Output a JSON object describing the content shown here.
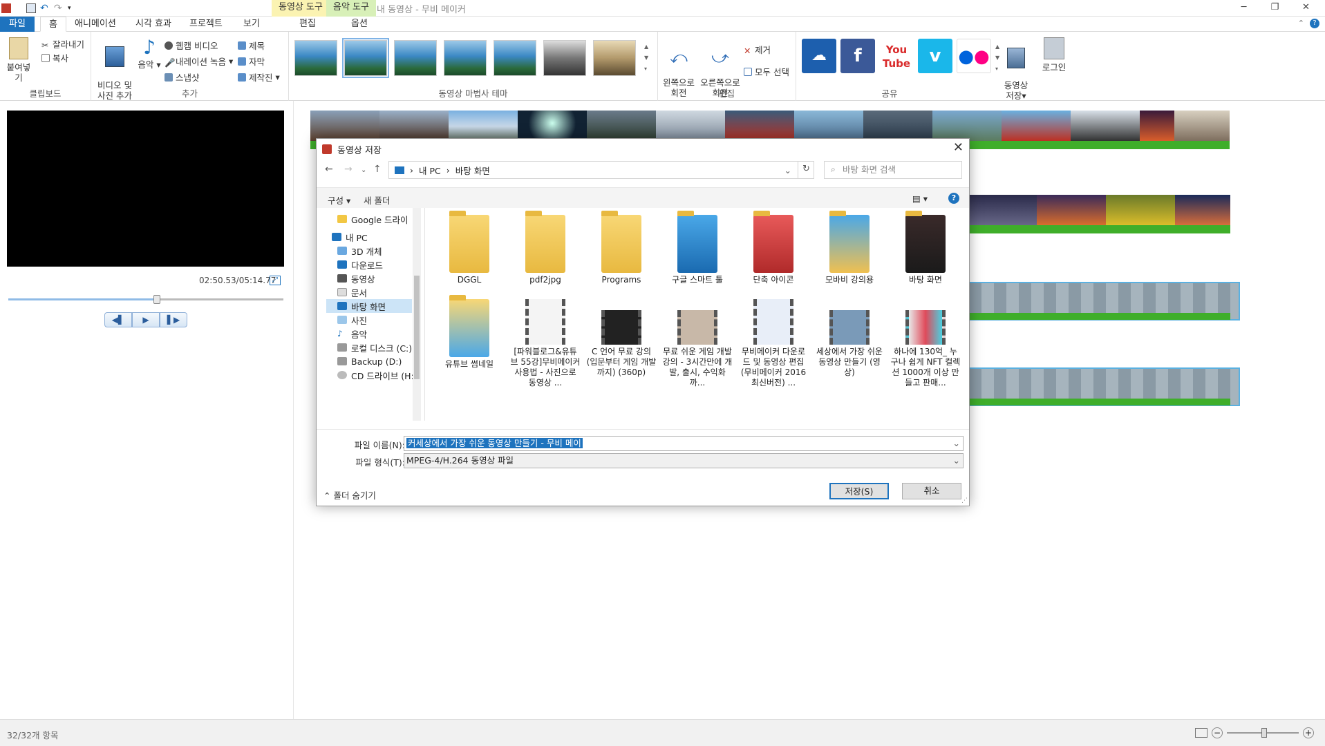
{
  "app": {
    "title": "내 동영상 - 무비 메이커"
  },
  "context_tabs": {
    "video_tools": "동영상 도구",
    "music_tools": "음악 도구",
    "edit": "편집",
    "options": "옵션"
  },
  "tabs": [
    "파일",
    "홈",
    "애니메이션",
    "시각 효과",
    "프로젝트",
    "보기"
  ],
  "ribbon": {
    "paste": "붙여넣기",
    "cut": "잘라내기",
    "copy": "복사",
    "clipboard": "클립보드",
    "add_video": "비디오 및\n사진 추가",
    "music": "음악",
    "webcam": "웹캠 비디오",
    "narration": "내레이션 녹음",
    "snapshot": "스냅샷",
    "title": "제목",
    "caption": "자막",
    "credits": "제작진",
    "add_group": "추가",
    "themes_group": "동영상 마법사 테마",
    "rotate_left": "왼쪽으로\n회전",
    "rotate_right": "오른쪽으로\n회전",
    "remove": "제거",
    "select_all": "모두 선택",
    "edit_group": "편집",
    "share_group": "공유",
    "save_movie": "동영상\n저장",
    "login": "로그인"
  },
  "player": {
    "time": "02:50.53/05:14.77",
    "progress": 0.54
  },
  "status": {
    "count": "32/32개 항목"
  },
  "dialog": {
    "title": "동영상 저장",
    "path": [
      "내 PC",
      "바탕 화면"
    ],
    "search_placeholder": "바탕 화면 검색",
    "organize": "구성",
    "new_folder": "새 폴더",
    "tree": [
      "Google 드라이",
      "내 PC",
      "3D 개체",
      "다운로드",
      "동영상",
      "문서",
      "바탕 화면",
      "사진",
      "음악",
      "로컬 디스크 (C:)",
      "Backup (D:)",
      "CD 드라이브 (H:"
    ],
    "files": [
      {
        "name": "DGGL",
        "kind": "folder"
      },
      {
        "name": "pdf2jpg",
        "kind": "folder"
      },
      {
        "name": "Programs",
        "kind": "folder"
      },
      {
        "name": "구글 스마트 툴",
        "kind": "folder"
      },
      {
        "name": "단축 아이콘",
        "kind": "folder"
      },
      {
        "name": "모바비 강의용",
        "kind": "folder"
      },
      {
        "name": "바탕 화면",
        "kind": "folder"
      },
      {
        "name": "유튜브 썸네일",
        "kind": "folder"
      },
      {
        "name": "[파워블로그&유튜브 55강]무비메이커 사용법 - 사진으로 동영상 ...",
        "kind": "video"
      },
      {
        "name": "C 언어 무료 강의 (입문부터 게임 개발까지) (360p)",
        "kind": "video"
      },
      {
        "name": "무료 쉬운 게임 개발 강의 - 3시간만에 개발, 출시, 수익화까...",
        "kind": "video"
      },
      {
        "name": "무비메이커 다운로드 및 동영상 편집 (무비메이커 2016최신버전) ...",
        "kind": "video"
      },
      {
        "name": "세상에서 가장 쉬운 동영상 만들기 (영상)",
        "kind": "video"
      },
      {
        "name": "하나에 130억_ 누구나 쉽게 NFT 컬렉션 1000개 이상 만들고 판매...",
        "kind": "video"
      }
    ],
    "filename_label": "파일 이름(N):",
    "filename_value": "커세상에서  가장 쉬운 동영상 만들기 - 무비 메이",
    "filetype_label": "파일 형식(T):",
    "filetype_value": "MPEG-4/H.264 동영상 파일",
    "hide_folders": "폴더 숨기기",
    "save": "저장(S)",
    "cancel": "취소"
  }
}
